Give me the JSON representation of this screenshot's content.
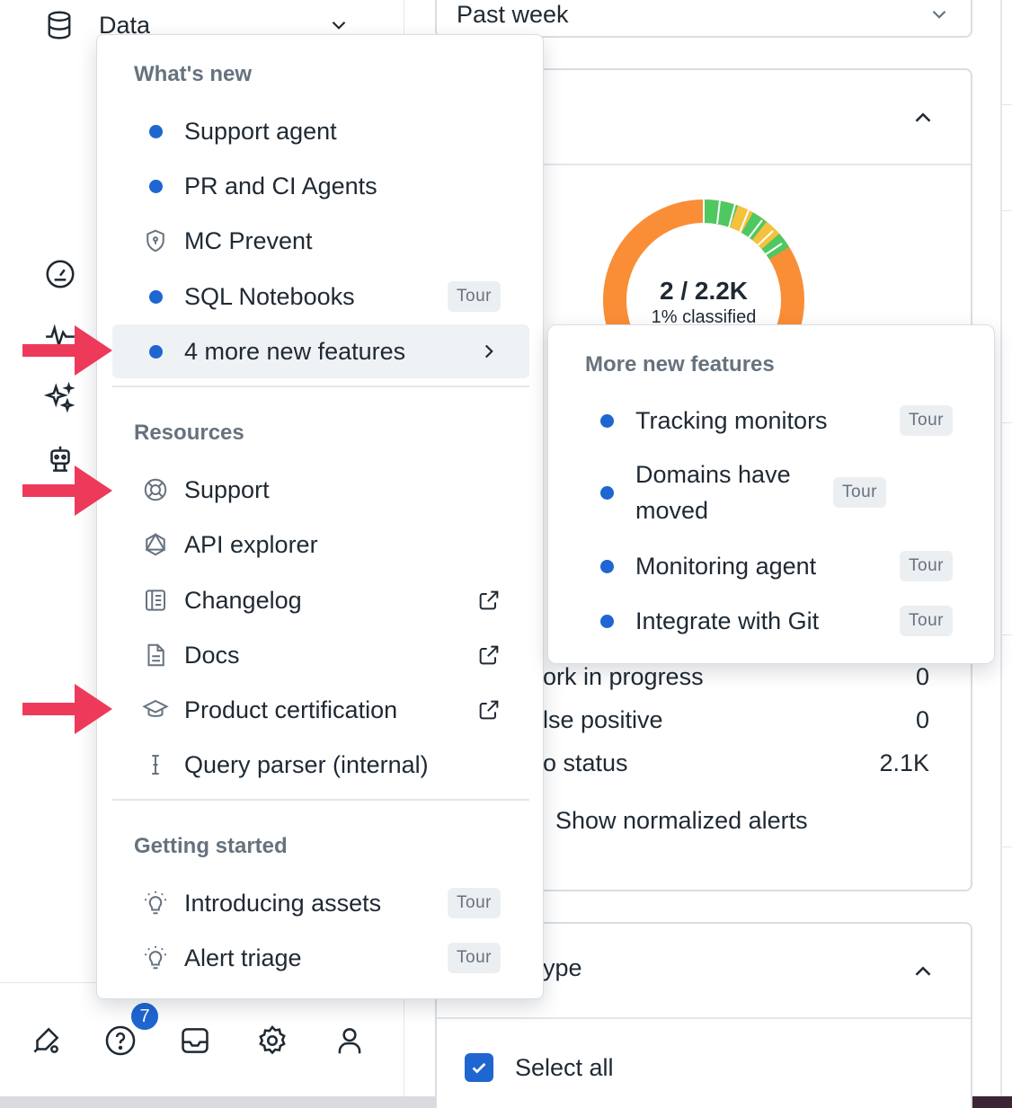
{
  "sidebar": {
    "section_label": "Data",
    "help_badge_count": "7"
  },
  "main": {
    "period": "Past week",
    "donut": {
      "total": "2 / 2.2K",
      "subtitle": "1% classified"
    },
    "stats": [
      {
        "label": "ork in progress",
        "value": "0"
      },
      {
        "label": "lse positive",
        "value": "0"
      },
      {
        "label": "o status",
        "value": "2.1K"
      }
    ],
    "normalized_label": "Show normalized alerts",
    "type_section_label": "ype",
    "select_all_label": "Select all"
  },
  "menu": {
    "whats_new_title": "What's new",
    "whats_new": [
      {
        "label": "Support agent"
      },
      {
        "label": "PR and CI Agents"
      },
      {
        "label": "MC Prevent"
      },
      {
        "label": "SQL Notebooks",
        "badge": "Tour"
      },
      {
        "label": "4 more new features"
      }
    ],
    "resources_title": "Resources",
    "resources": [
      {
        "label": "Support"
      },
      {
        "label": "API explorer"
      },
      {
        "label": "Changelog"
      },
      {
        "label": "Docs"
      },
      {
        "label": "Product certification"
      },
      {
        "label": "Query parser (internal)"
      }
    ],
    "getting_started_title": "Getting started",
    "getting_started": [
      {
        "label": "Introducing assets",
        "badge": "Tour"
      },
      {
        "label": "Alert triage",
        "badge": "Tour"
      }
    ]
  },
  "submenu": {
    "title": "More new features",
    "items": [
      {
        "label": "Tracking monitors",
        "badge": "Tour"
      },
      {
        "label": "Domains have moved",
        "badge": "Tour"
      },
      {
        "label": "Monitoring agent",
        "badge": "Tour"
      },
      {
        "label": "Integrate with Git",
        "badge": "Tour"
      }
    ]
  },
  "colors": {
    "accent": "#1f66d1",
    "arrow": "#ee3a5a",
    "donut_orange": "#f98e36",
    "donut_green": "#4fc862",
    "donut_yellow": "#f5c23d"
  }
}
